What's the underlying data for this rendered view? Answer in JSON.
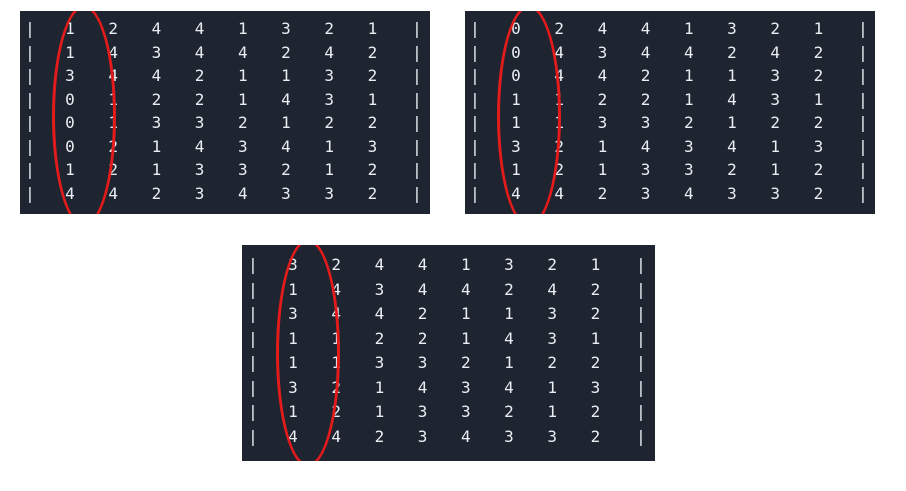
{
  "colors": {
    "panel_background": "#1e2430",
    "text": "#e9eef3",
    "highlight_ellipse": "#e31b1b",
    "page_background": "#ffffff"
  },
  "border_char": "|",
  "panels": [
    {
      "name": "matrix-panel-top-left",
      "rows": [
        [
          "1",
          "2",
          "4",
          "4",
          "1",
          "3",
          "2",
          "1"
        ],
        [
          "1",
          "4",
          "3",
          "4",
          "4",
          "2",
          "4",
          "2"
        ],
        [
          "3",
          "4",
          "4",
          "2",
          "1",
          "1",
          "3",
          "2"
        ],
        [
          "0",
          "1",
          "2",
          "2",
          "1",
          "4",
          "3",
          "1"
        ],
        [
          "0",
          "1",
          "3",
          "3",
          "2",
          "1",
          "2",
          "2"
        ],
        [
          "0",
          "2",
          "1",
          "4",
          "3",
          "4",
          "1",
          "3"
        ],
        [
          "1",
          "2",
          "1",
          "3",
          "3",
          "2",
          "1",
          "2"
        ],
        [
          "4",
          "4",
          "2",
          "3",
          "4",
          "3",
          "3",
          "2"
        ]
      ]
    },
    {
      "name": "matrix-panel-top-right",
      "rows": [
        [
          "0",
          "2",
          "4",
          "4",
          "1",
          "3",
          "2",
          "1"
        ],
        [
          "0",
          "4",
          "3",
          "4",
          "4",
          "2",
          "4",
          "2"
        ],
        [
          "0",
          "4",
          "4",
          "2",
          "1",
          "1",
          "3",
          "2"
        ],
        [
          "1",
          "1",
          "2",
          "2",
          "1",
          "4",
          "3",
          "1"
        ],
        [
          "1",
          "1",
          "3",
          "3",
          "2",
          "1",
          "2",
          "2"
        ],
        [
          "3",
          "2",
          "1",
          "4",
          "3",
          "4",
          "1",
          "3"
        ],
        [
          "1",
          "2",
          "1",
          "3",
          "3",
          "2",
          "1",
          "2"
        ],
        [
          "4",
          "4",
          "2",
          "3",
          "4",
          "3",
          "3",
          "2"
        ]
      ]
    },
    {
      "name": "matrix-panel-bottom",
      "rows": [
        [
          "3",
          "2",
          "4",
          "4",
          "1",
          "3",
          "2",
          "1"
        ],
        [
          "1",
          "4",
          "3",
          "4",
          "4",
          "2",
          "4",
          "2"
        ],
        [
          "3",
          "4",
          "4",
          "2",
          "1",
          "1",
          "3",
          "2"
        ],
        [
          "1",
          "1",
          "2",
          "2",
          "1",
          "4",
          "3",
          "1"
        ],
        [
          "1",
          "1",
          "3",
          "3",
          "2",
          "1",
          "2",
          "2"
        ],
        [
          "3",
          "2",
          "1",
          "4",
          "3",
          "4",
          "1",
          "3"
        ],
        [
          "1",
          "2",
          "1",
          "3",
          "3",
          "2",
          "1",
          "2"
        ],
        [
          "4",
          "4",
          "2",
          "3",
          "4",
          "3",
          "3",
          "2"
        ]
      ]
    }
  ]
}
